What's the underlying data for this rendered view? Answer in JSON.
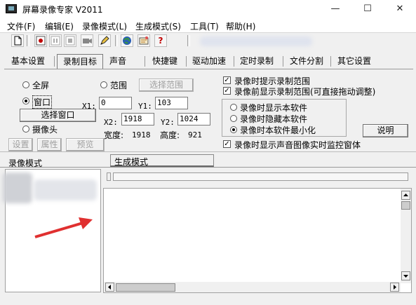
{
  "window": {
    "title": "屏幕录像专家 V2011",
    "controls": {
      "minimize": "—",
      "maximize": "☐",
      "close": "✕"
    }
  },
  "menu": [
    "文件(F)",
    "编辑(E)",
    "录像模式(L)",
    "生成模式(S)",
    "工具(T)",
    "帮助(H)"
  ],
  "toolbar": {
    "icons": [
      "new-file-icon",
      "record-icon",
      "pause-icon",
      "stop-icon",
      "camera-icon",
      "pencil-icon",
      "globe-icon",
      "settings-icon",
      "help-icon"
    ],
    "help_glyph": "?"
  },
  "tabs": [
    "基本设置",
    "录制目标",
    "声音",
    "快捷键",
    "驱动加速",
    "定时录制",
    "文件分割",
    "其它设置"
  ],
  "active_tab": "录制目标",
  "record_target": {
    "fullscreen_label": "全屏",
    "range_label": "范围",
    "select_range_button": "选择范围",
    "window_label": "窗口",
    "select_window_button": "选择窗口",
    "camera_label": "摄像头",
    "settings_button": "设置",
    "properties_button": "属性",
    "preview_button": "预览",
    "selected_mode": "窗口",
    "x1_label": "X1:",
    "x1_value": "0",
    "y1_label": "Y1:",
    "y1_value": "103",
    "x2_label": "X2:",
    "x2_value": "1918",
    "y2_label": "Y2:",
    "y2_value": "1024",
    "width_label": "宽度:",
    "width_value": "1918",
    "height_label": "高度:",
    "height_value": "921"
  },
  "options": {
    "prompt_range": {
      "label": "录像时提示录制范围",
      "checked": true
    },
    "show_range_before": {
      "label": "录像前显示录制范围(可直接拖动调整)",
      "checked": true
    },
    "software_display": [
      "录像时显示本软件",
      "录像时隐藏本软件",
      "录像时本软件最小化"
    ],
    "software_display_selected": "录像时本软件最小化",
    "explain_button": "说明",
    "show_monitor": {
      "label": "录像时显示声音图像实时监控窗体",
      "checked": true
    }
  },
  "lower": {
    "record_mode_tab": "录像模式",
    "generate_mode_tab": "生成模式"
  },
  "colors": {
    "arrow": "#e03030",
    "accent": "#c00000"
  }
}
